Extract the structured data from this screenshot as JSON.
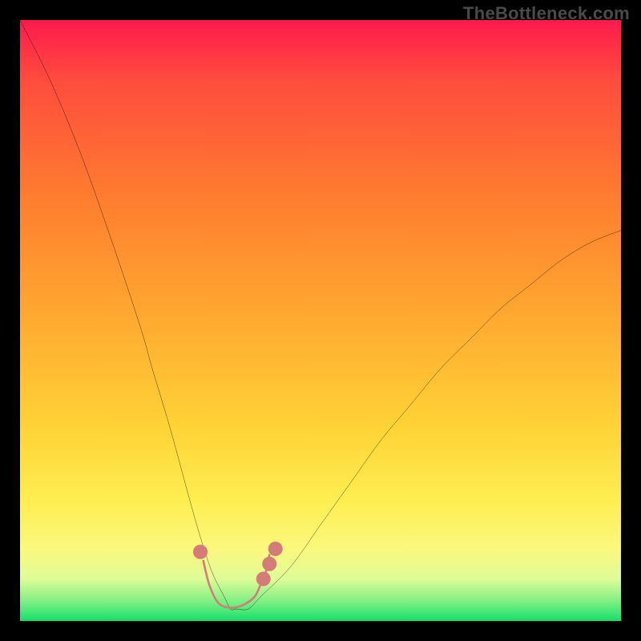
{
  "watermark": "TheBottleneck.com",
  "chart_data": {
    "type": "line",
    "title": "",
    "xlabel": "",
    "ylabel": "",
    "xlim": [
      0,
      100
    ],
    "ylim": [
      0,
      100
    ],
    "grid": false,
    "legend": false,
    "gradient_bands": [
      {
        "name": "red-top",
        "color": "#ff1a4d"
      },
      {
        "name": "orange",
        "color": "#ff8a2b"
      },
      {
        "name": "yellow",
        "color": "#ffe93b"
      },
      {
        "name": "pale-yellow",
        "color": "#f9ff9e"
      },
      {
        "name": "green-bottom",
        "color": "#13e06c"
      }
    ],
    "series": [
      {
        "name": "bottleneck-curve",
        "stroke": "#000000",
        "x": [
          0,
          5,
          10,
          15,
          20,
          22,
          25,
          28,
          30,
          32,
          34,
          35,
          36,
          38,
          40,
          45,
          50,
          55,
          60,
          65,
          70,
          75,
          80,
          85,
          90,
          95,
          100
        ],
        "values": [
          100,
          90,
          78,
          64,
          49,
          42,
          32,
          21,
          14,
          8,
          4,
          2,
          2,
          2,
          4,
          9,
          16,
          23,
          30,
          36,
          42,
          47,
          52,
          56,
          60,
          63,
          65
        ]
      },
      {
        "name": "trough-marker-shape",
        "stroke": "#d57b79",
        "fill": "none",
        "x": [
          30.5,
          31.5,
          33.0,
          35.0,
          37.0,
          39.0,
          40.0,
          41.0,
          41.5
        ],
        "values": [
          10.0,
          6.0,
          3.0,
          2.2,
          2.6,
          4.0,
          6.0,
          8.5,
          11.0
        ]
      }
    ],
    "markers": [
      {
        "name": "pt-1",
        "x": 30.0,
        "y": 11.5,
        "r": 1.2,
        "color": "#d57b79"
      },
      {
        "name": "pt-2",
        "x": 40.5,
        "y": 7.0,
        "r": 1.2,
        "color": "#d57b79"
      },
      {
        "name": "pt-3",
        "x": 41.5,
        "y": 9.5,
        "r": 1.2,
        "color": "#d57b79"
      },
      {
        "name": "pt-4",
        "x": 42.5,
        "y": 12.0,
        "r": 1.2,
        "color": "#d57b79"
      }
    ]
  }
}
